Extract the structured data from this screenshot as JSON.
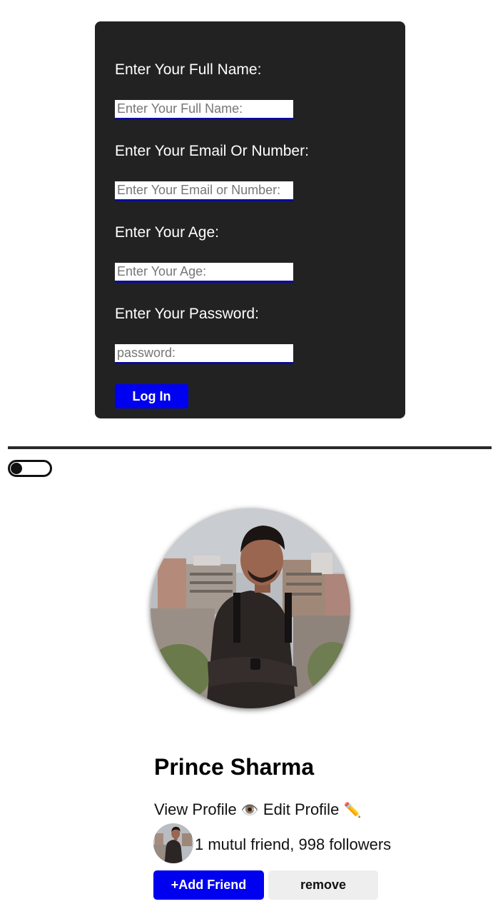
{
  "login_form": {
    "fields": [
      {
        "label": "Enter Your Full Name:",
        "placeholder": "Enter Your Full Name:",
        "value": ""
      },
      {
        "label": "Enter Your Email Or Number:",
        "placeholder": "Enter Your Email or Number:",
        "value": ""
      },
      {
        "label": "Enter Your Age:",
        "placeholder": "Enter Your Age:",
        "value": ""
      },
      {
        "label": "Enter Your Password:",
        "placeholder": "password:",
        "value": ""
      }
    ],
    "submit_label": "Log In",
    "colors": {
      "card_bg": "#222222",
      "accent": "#0000f0",
      "input_underline": "#0b0b9a"
    }
  },
  "theme_toggle": {
    "state": "off"
  },
  "profile": {
    "name": "Prince Sharma",
    "view_profile_label": "View Profile",
    "view_profile_icon": "👁️",
    "edit_profile_label": "Edit Profile",
    "edit_profile_icon": "✏️",
    "friends_text": "1 mutul friend, 998 followers",
    "add_friend_label": "+Add Friend",
    "remove_label": "remove",
    "colors": {
      "add_button": "#0000f0",
      "remove_button": "#eeeeee"
    }
  }
}
